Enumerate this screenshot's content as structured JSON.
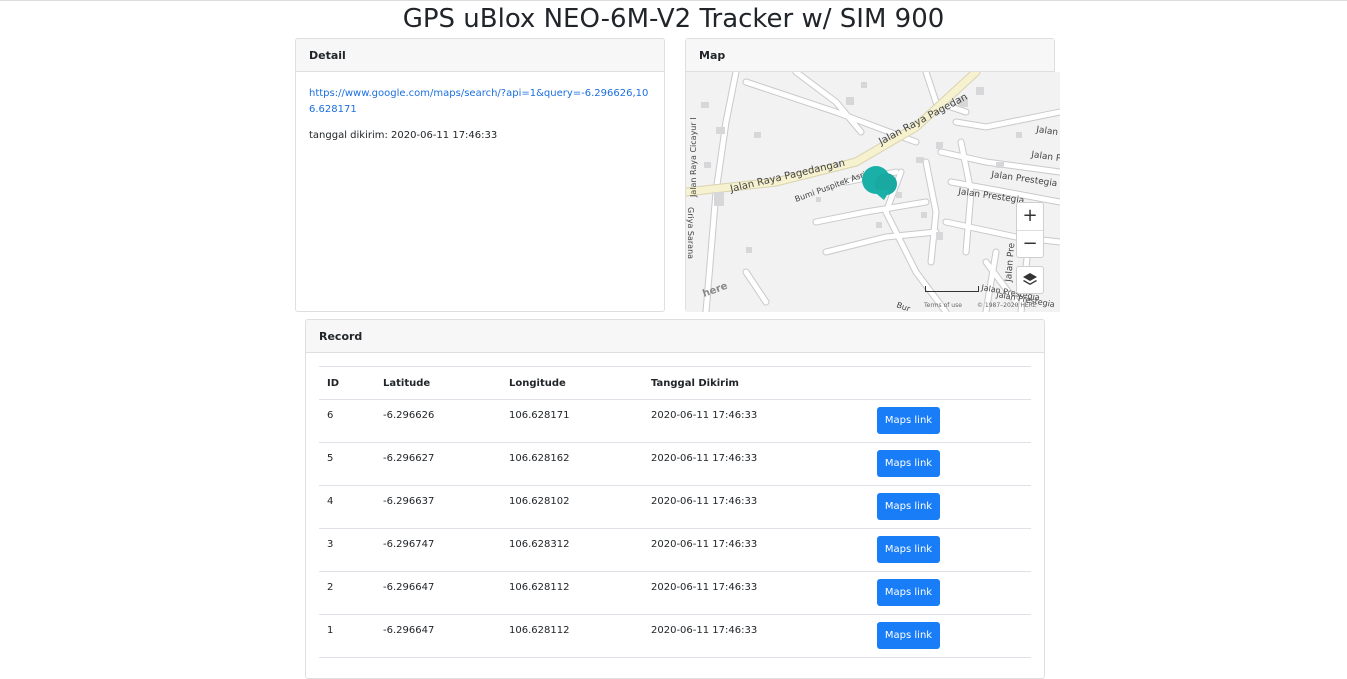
{
  "page": {
    "title": "GPS uBlox NEO-6M-V2 Tracker w/ SIM 900"
  },
  "detail": {
    "header": "Detail",
    "link_text": "https://www.google.com/maps/search/?api=1&query=-6.296626,106.628171",
    "sent_text": "tanggal dikirim: 2020-06-11 17:46:33"
  },
  "map": {
    "header": "Map",
    "labels": {
      "road_main": "Jalan Raya Pagedangan",
      "road_main_upper": "Jalan Raya Pagedan",
      "road_cicayur": "Jalan Raya Cicayur I",
      "road_griya": "Griya Sarana",
      "bumi": "Bumi Puspitek Asri",
      "prestegia_1": "Jalan Prestegia",
      "prestegia_2": "Jalan Prestegia",
      "prestegia_3": "Jalan Prestegia",
      "prestegia_4": "Jalan Prestegia",
      "jalan_1": "Jalan",
      "jalan_2": "Jalan Pre",
      "jalan_vertical": "Jalan Pre",
      "bur": "Bur",
      "here_logo": "here"
    },
    "zoom_in": "+",
    "zoom_out": "−",
    "attribution_terms": "Terms of use",
    "attribution_copy": "© 1987–2020 HERE",
    "marker_color": "#1ab0a8"
  },
  "record": {
    "header": "Record",
    "columns": [
      "ID",
      "Latitude",
      "Longitude",
      "Tanggal Dikirim"
    ],
    "rows": [
      {
        "id": "6",
        "lat": "-6.296626",
        "lon": "106.628171",
        "date": "2020-06-11 17:46:33",
        "button": "Maps link"
      },
      {
        "id": "5",
        "lat": "-6.296627",
        "lon": "106.628162",
        "date": "2020-06-11 17:46:33",
        "button": "Maps link"
      },
      {
        "id": "4",
        "lat": "-6.296637",
        "lon": "106.628102",
        "date": "2020-06-11 17:46:33",
        "button": "Maps link"
      },
      {
        "id": "3",
        "lat": "-6.296747",
        "lon": "106.628312",
        "date": "2020-06-11 17:46:33",
        "button": "Maps link"
      },
      {
        "id": "2",
        "lat": "-6.296647",
        "lon": "106.628112",
        "date": "2020-06-11 17:46:33",
        "button": "Maps link"
      },
      {
        "id": "1",
        "lat": "-6.296647",
        "lon": "106.628112",
        "date": "2020-06-11 17:46:33",
        "button": "Maps link"
      }
    ]
  },
  "colors": {
    "accent": "#1a7df8",
    "link": "#1b6fe0",
    "header_bg": "#f7f7f7",
    "map_bg": "#f2f2f3"
  }
}
